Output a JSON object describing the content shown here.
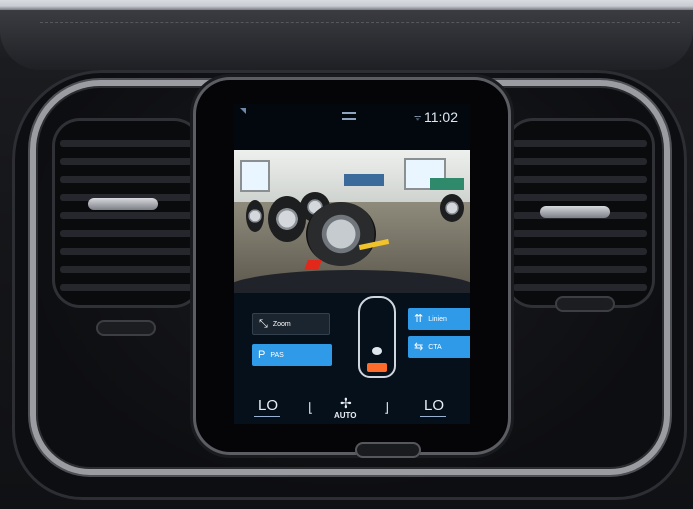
{
  "status_bar": {
    "time": "11:02",
    "signal": "ᯤ"
  },
  "camera_view": {
    "description_icon": "rear-camera-feed"
  },
  "park_controls": {
    "zoom_label": "Zoom",
    "pas_label": "PAS",
    "linien_label": "Linien",
    "cta_label": "CTA"
  },
  "climate_bar": {
    "left_temp": "LO",
    "right_temp": "LO",
    "fan_mode": "AUTO"
  },
  "colors": {
    "accent_blue": "#2f9be8",
    "alert_orange": "#ff6b2a",
    "guide_red": "#e1281b",
    "guide_yellow": "#f0c22b"
  },
  "icons": {
    "zoom": "zoom-icon",
    "pas": "park-assist-icon",
    "linien": "guide-lines-icon",
    "cta": "cross-traffic-alert-icon",
    "fan": "fan-icon",
    "seat_left": "seat-heat-left-icon",
    "seat_right": "seat-heat-right-icon"
  }
}
